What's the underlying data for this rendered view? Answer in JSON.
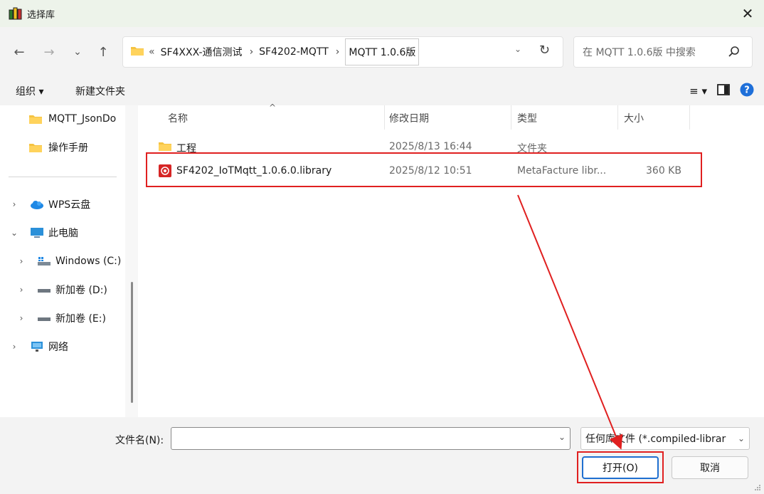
{
  "window": {
    "title": "选择库",
    "close_glyph": "✕"
  },
  "nav": {
    "back_glyph": "←",
    "forward_glyph": "→",
    "recent_glyph": "⌄",
    "up_glyph": "↑",
    "breadcrumb": {
      "overflow": "«",
      "items": [
        "SF4XXX-通信测试",
        "SF4202-MQTT"
      ],
      "separator": "›",
      "current": "MQTT 1.0.6版"
    },
    "dropdown_glyph": "⌄",
    "refresh_glyph": "↻",
    "search_placeholder": "在 MQTT 1.0.6版 中搜索"
  },
  "toolbar": {
    "organize": "组织 ▾",
    "new_folder": "新建文件夹",
    "view_glyph": "≡ ▾",
    "help_glyph": "?"
  },
  "sidebar": {
    "items": [
      {
        "label": "MQTT_JsonDo",
        "icon": "folder-icon",
        "chev": ""
      },
      {
        "label": "操作手册",
        "icon": "folder-icon",
        "chev": ""
      },
      {
        "label": "WPS云盘",
        "icon": "cloud-icon",
        "chev": "›"
      },
      {
        "label": "此电脑",
        "icon": "pc-icon",
        "chev": "⌄"
      },
      {
        "label": "Windows (C:)",
        "icon": "windows-drive-icon",
        "chev": "›"
      },
      {
        "label": "新加卷 (D:)",
        "icon": "drive-icon",
        "chev": "›"
      },
      {
        "label": "新加卷 (E:)",
        "icon": "drive-icon",
        "chev": "›"
      },
      {
        "label": "网络",
        "icon": "network-icon",
        "chev": "›"
      }
    ]
  },
  "file_list": {
    "sort_glyph": "^",
    "columns": [
      "名称",
      "修改日期",
      "类型",
      "大小"
    ],
    "rows": [
      {
        "name": "工程",
        "modified": "2025/8/13 16:44",
        "type": "文件夹",
        "size": "",
        "icon": "folder-icon"
      },
      {
        "name": "SF4202_IoTMqtt_1.0.6.0.library",
        "modified": "2025/8/12 10:51",
        "type": "MetaFacture libr...",
        "size": "360 KB",
        "icon": "library-file-icon"
      }
    ]
  },
  "footer": {
    "filename_label": "文件名(N):",
    "filename_value": "",
    "filter_label": "任何库文件 (*.compiled-librar",
    "open_label": "打开(O)",
    "cancel_label": "取消"
  },
  "colors": {
    "annotation": "#e02020",
    "accent": "#1f6fd0",
    "folder": "#f5c342"
  }
}
